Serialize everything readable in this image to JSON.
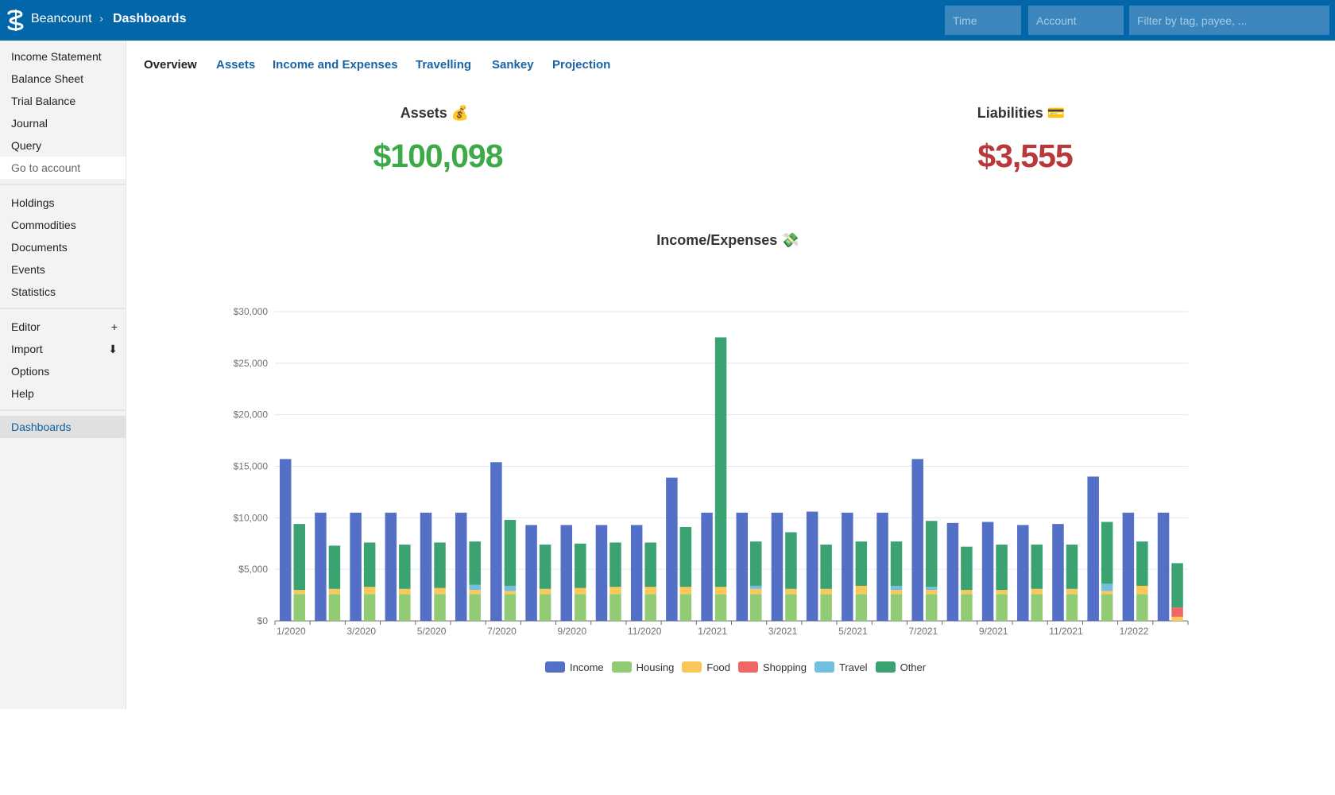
{
  "header": {
    "brand": "Beancount",
    "separator": "›",
    "current": "Dashboards",
    "time_placeholder": "Time",
    "account_placeholder": "Account",
    "filter_placeholder": "Filter by tag, payee, ..."
  },
  "sidebar": {
    "group1": [
      "Income Statement",
      "Balance Sheet",
      "Trial Balance",
      "Journal",
      "Query"
    ],
    "goto": "Go to account",
    "group2": [
      "Holdings",
      "Commodities",
      "Documents",
      "Events",
      "Statistics"
    ],
    "group3": [
      {
        "label": "Editor",
        "action": "+"
      },
      {
        "label": "Import",
        "action": "⬇"
      },
      {
        "label": "Options",
        "action": ""
      },
      {
        "label": "Help",
        "action": ""
      }
    ],
    "active": "Dashboards"
  },
  "tabs": [
    "Overview",
    "Assets",
    "Income and Expenses",
    "Travelling",
    "Sankey",
    "Projection"
  ],
  "stats": {
    "assets_title": "Assets 💰",
    "assets_value": "$100,098",
    "liabilities_title": "Liabilities 💳",
    "liabilities_value": "$3,555"
  },
  "colors": {
    "header": "#0366a8",
    "Income": "#5470c6",
    "Housing": "#91cc75",
    "Food": "#fac858",
    "Shopping": "#ee6666",
    "Travel": "#73c0de",
    "Other": "#3ba272",
    "assets": "#3daa47",
    "liabilities": "#b8383b"
  },
  "chart_data": {
    "type": "bar",
    "title": "Income/Expenses 💸",
    "ylim": [
      0,
      30000
    ],
    "yticks": [
      "$0",
      "$5,000",
      "$10,000",
      "$15,000",
      "$20,000",
      "$25,000",
      "$30,000"
    ],
    "xticks": [
      "1/2020",
      "3/2020",
      "5/2020",
      "7/2020",
      "9/2020",
      "11/2020",
      "1/2021",
      "3/2021",
      "5/2021",
      "7/2021",
      "9/2021",
      "11/2021",
      "1/2022"
    ],
    "grid": true,
    "legend_position": "bottom",
    "categories": [
      "1/2020",
      "2/2020",
      "3/2020",
      "4/2020",
      "5/2020",
      "6/2020",
      "7/2020",
      "8/2020",
      "9/2020",
      "10/2020",
      "11/2020",
      "12/2020",
      "1/2021",
      "2/2021",
      "3/2021",
      "4/2021",
      "5/2021",
      "6/2021",
      "7/2021",
      "8/2021",
      "9/2021",
      "10/2021",
      "11/2021",
      "12/2021",
      "1/2022",
      "2/2022"
    ],
    "series": [
      {
        "name": "Income",
        "values": [
          15700,
          10500,
          10500,
          10500,
          10500,
          10500,
          15400,
          9300,
          9300,
          9300,
          9300,
          13900,
          10500,
          10500,
          10500,
          10600,
          10500,
          10500,
          15700,
          9500,
          9600,
          9300,
          9400,
          14000,
          10500,
          10500
        ]
      },
      {
        "name": "Housing",
        "values": [
          2600,
          2600,
          2600,
          2600,
          2600,
          2600,
          2600,
          2600,
          2600,
          2600,
          2600,
          2600,
          2600,
          2600,
          2600,
          2600,
          2600,
          2600,
          2600,
          2600,
          2600,
          2600,
          2600,
          2600,
          2600,
          0
        ]
      },
      {
        "name": "Food",
        "values": [
          400,
          500,
          700,
          500,
          600,
          400,
          300,
          500,
          600,
          700,
          700,
          700,
          700,
          500,
          500,
          500,
          800,
          400,
          400,
          400,
          400,
          500,
          500,
          300,
          800,
          400
        ]
      },
      {
        "name": "Shopping",
        "values": [
          0,
          0,
          0,
          0,
          0,
          0,
          0,
          0,
          0,
          0,
          0,
          0,
          0,
          0,
          0,
          0,
          0,
          0,
          0,
          0,
          0,
          0,
          0,
          0,
          0,
          900
        ]
      },
      {
        "name": "Travel",
        "values": [
          0,
          0,
          0,
          0,
          0,
          500,
          500,
          0,
          0,
          0,
          0,
          0,
          0,
          300,
          0,
          0,
          0,
          400,
          300,
          0,
          0,
          0,
          0,
          700,
          0,
          0
        ]
      },
      {
        "name": "Other",
        "values": [
          6400,
          4200,
          4300,
          4300,
          4400,
          4200,
          6400,
          4300,
          4300,
          4300,
          4300,
          5800,
          24200,
          4300,
          5500,
          4300,
          4300,
          4300,
          6400,
          4200,
          4400,
          4300,
          4300,
          6000,
          4300,
          4300
        ]
      }
    ]
  }
}
